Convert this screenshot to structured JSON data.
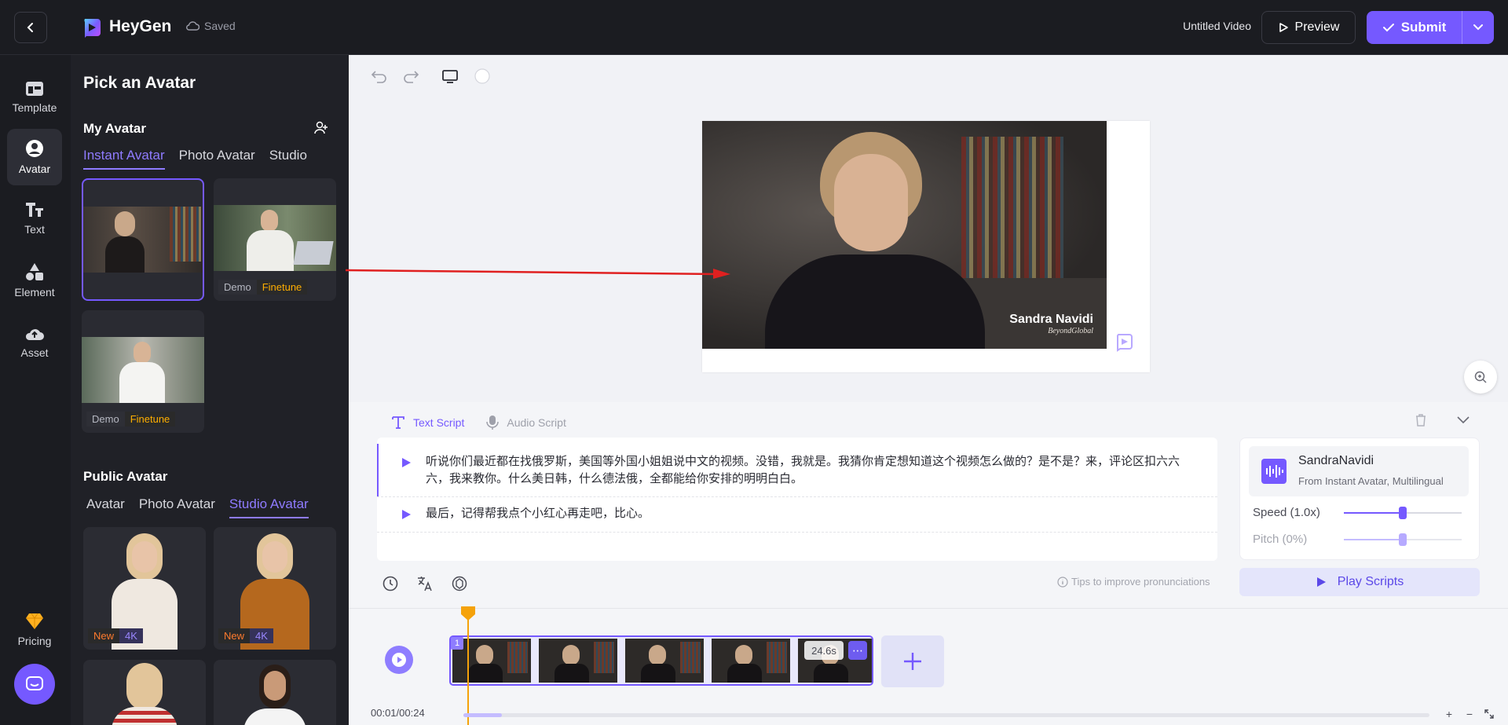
{
  "topbar": {
    "brand": "HeyGen",
    "saved": "Saved",
    "video_title": "Untitled Video",
    "preview_label": "Preview",
    "submit_label": "Submit"
  },
  "rail": {
    "items": [
      {
        "label": "Template",
        "icon": "template-icon"
      },
      {
        "label": "Avatar",
        "icon": "avatar-icon"
      },
      {
        "label": "Text",
        "icon": "text-icon"
      },
      {
        "label": "Element",
        "icon": "element-icon"
      },
      {
        "label": "Asset",
        "icon": "asset-icon"
      }
    ],
    "pricing_label": "Pricing"
  },
  "panel": {
    "title": "Pick an Avatar",
    "my_avatar": {
      "title": "My Avatar",
      "tabs": [
        "Instant Avatar",
        "Photo Avatar",
        "Studio"
      ],
      "cards": [
        {
          "tags": []
        },
        {
          "tags": [
            "Demo",
            "Finetune"
          ]
        },
        {
          "tags": [
            "Demo",
            "Finetune"
          ]
        }
      ]
    },
    "public_avatar": {
      "title": "Public Avatar",
      "tabs": [
        "Avatar",
        "Photo Avatar",
        "Studio Avatar"
      ],
      "cards": [
        {
          "tags": [
            "New",
            "4K"
          ]
        },
        {
          "tags": [
            "New",
            "4K"
          ]
        }
      ]
    }
  },
  "video": {
    "name": "Sandra Navidi",
    "subtitle": "BeyondGlobal"
  },
  "script": {
    "tabs": [
      "Text Script",
      "Audio Script"
    ],
    "lines": [
      "听说你们最近都在找俄罗斯，美国等外国小姐姐说中文的视频。没错，我就是。我猜你肯定想知道这个视频怎么做的？是不是？来，评论区扣六六六，我来教你。什么美日韩，什么德法俄，全都能给你安排的明明白白。",
      "最后，记得帮我点个小红心再走吧，比心。"
    ],
    "tips": "Tips to improve pronunciations"
  },
  "voice": {
    "name": "SandraNavidi",
    "source": "From Instant Avatar, Multilingual",
    "speed_label": "Speed (1.0x)",
    "speed": 0.5,
    "pitch_label": "Pitch (0%)",
    "pitch": 0.5,
    "play_label": "Play Scripts"
  },
  "timeline": {
    "scene_number": "1",
    "duration": "24.6s",
    "timecode": "00:01/00:24",
    "progress": 0.04
  },
  "colors": {
    "accent": "#7559ff",
    "gold": "#ffae00",
    "arrow": "#e02020"
  }
}
